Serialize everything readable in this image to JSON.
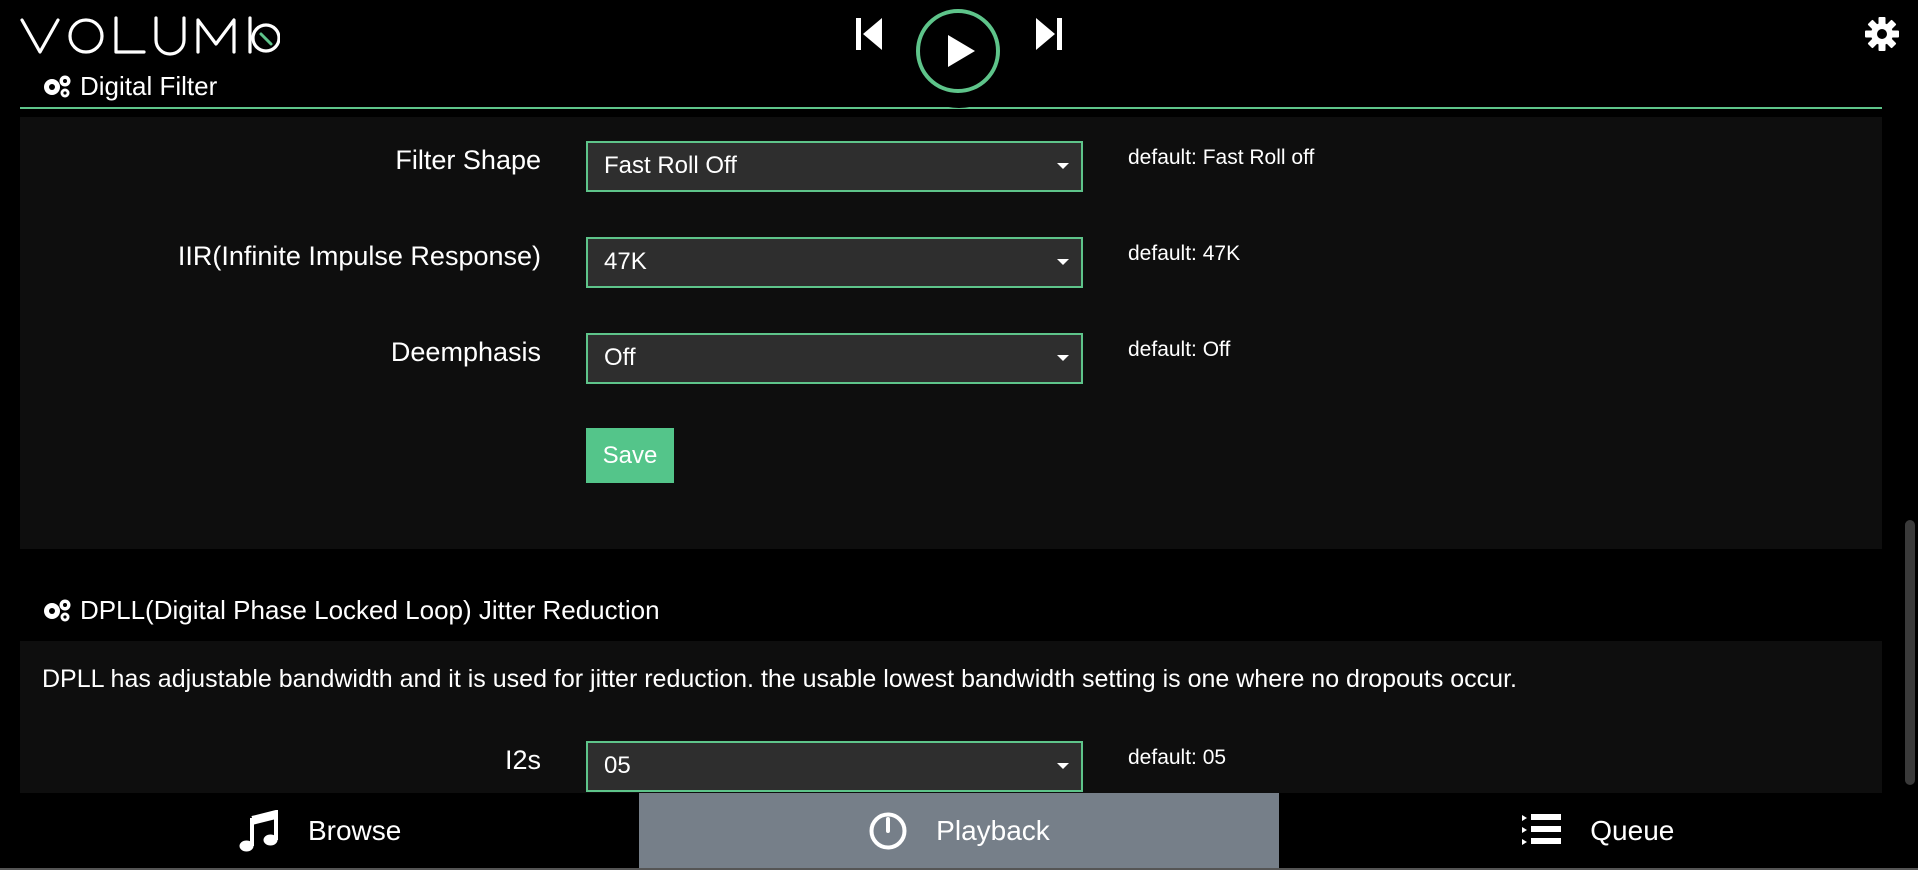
{
  "header": {
    "logo_text": "VOLUMIO"
  },
  "sections": [
    {
      "title": "Digital Filter",
      "rows": [
        {
          "label": "Filter Shape",
          "value": "Fast Roll Off",
          "default": "default: Fast Roll off"
        },
        {
          "label": "IIR(Infinite Impulse Response)",
          "value": "47K",
          "default": "default: 47K"
        },
        {
          "label": "Deemphasis",
          "value": "Off",
          "default": "default: Off"
        }
      ],
      "save_label": "Save"
    },
    {
      "title": "DPLL(Digital Phase Locked Loop) Jitter Reduction",
      "description": "DPLL has adjustable bandwidth and it is used for jitter reduction. the usable lowest bandwidth setting is one where no dropouts occur.",
      "rows": [
        {
          "label": "I2s",
          "value": "05",
          "default": "default: 05"
        }
      ]
    }
  ],
  "footer": {
    "tabs": [
      {
        "label": "Browse",
        "icon": "music-note-icon",
        "active": false
      },
      {
        "label": "Playback",
        "icon": "dial-icon",
        "active": true
      },
      {
        "label": "Queue",
        "icon": "list-icon",
        "active": false
      }
    ]
  },
  "colors": {
    "accent": "#5ec48a",
    "save_button": "#54c58a",
    "active_tab": "#767f89"
  }
}
